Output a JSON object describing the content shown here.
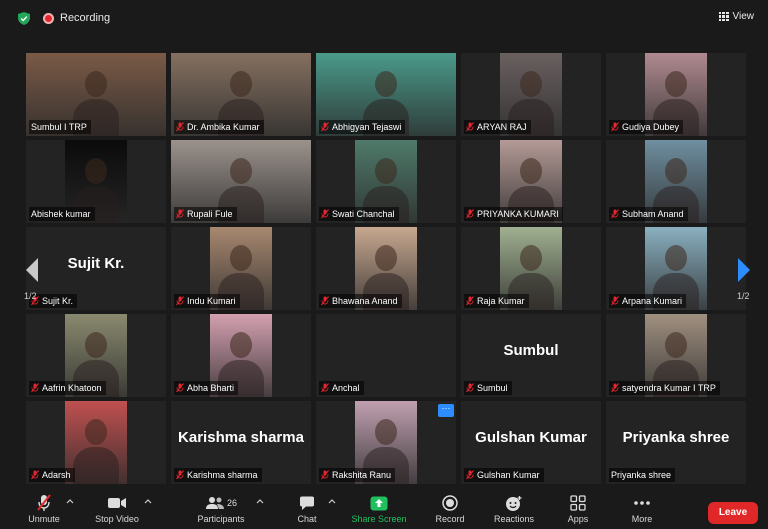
{
  "top_bar": {
    "recording_label": "Recording",
    "view_label": "View"
  },
  "gallery": {
    "page_indicator_left": "1/2",
    "page_indicator_right": "1/2",
    "tiles": [
      {
        "name": "Sumbul I TRP",
        "muted": false,
        "video_tone": "#7a5a47",
        "big_name": ""
      },
      {
        "name": "Dr. Ambika Kumar",
        "muted": true,
        "video_tone": "#857060",
        "big_name": ""
      },
      {
        "name": "Abhigyan Tejaswi",
        "muted": true,
        "video_tone": "#4a9a8a",
        "big_name": ""
      },
      {
        "name": "ARYAN RAJ",
        "muted": true,
        "video_tone": "#6a6060",
        "big_name": ""
      },
      {
        "name": "Gudiya Dubey",
        "muted": true,
        "video_tone": "#b08a90",
        "big_name": ""
      },
      {
        "name": "Abishek kumar",
        "muted": false,
        "video_tone": "#0b0b0b",
        "big_name": ""
      },
      {
        "name": "Rupali Fule",
        "muted": true,
        "video_tone": "#9b928c",
        "big_name": ""
      },
      {
        "name": "Swati Chanchal",
        "muted": true,
        "video_tone": "#4f7a6a",
        "big_name": ""
      },
      {
        "name": "PRIYANKA KUMARI",
        "muted": true,
        "video_tone": "#b49a96",
        "big_name": ""
      },
      {
        "name": "Subham Anand",
        "muted": true,
        "video_tone": "#6f8fa0",
        "big_name": ""
      },
      {
        "name": "Sujit Kr.",
        "muted": true,
        "video_tone": "",
        "big_name": "Sujit Kr."
      },
      {
        "name": "Indu Kumari",
        "muted": true,
        "video_tone": "#a88870",
        "big_name": ""
      },
      {
        "name": "Bhawana Anand",
        "muted": true,
        "video_tone": "#c8a890",
        "big_name": ""
      },
      {
        "name": "Raja Kumar",
        "muted": true,
        "video_tone": "#a0b090",
        "big_name": ""
      },
      {
        "name": "Arpana Kumari",
        "muted": true,
        "video_tone": "#8ab0c0",
        "big_name": ""
      },
      {
        "name": "Aafrin Khatoon",
        "muted": true,
        "video_tone": "#8a8a70",
        "big_name": ""
      },
      {
        "name": "Abha Bharti",
        "muted": true,
        "video_tone": "#d4a0b0",
        "big_name": ""
      },
      {
        "name": "Anchal",
        "muted": true,
        "video_tone": "",
        "big_name": ""
      },
      {
        "name": "Sumbul",
        "muted": true,
        "video_tone": "",
        "big_name": "Sumbul"
      },
      {
        "name": "satyendra Kumar I TRP",
        "muted": true,
        "video_tone": "#a09080",
        "big_name": ""
      },
      {
        "name": "Adarsh",
        "muted": true,
        "video_tone": "#c05050",
        "big_name": ""
      },
      {
        "name": "Karishma sharma",
        "muted": true,
        "video_tone": "",
        "big_name": "Karishma sharma"
      },
      {
        "name": "Rakshita Ranu",
        "muted": true,
        "video_tone": "#c0a0b0",
        "big_name": ""
      },
      {
        "name": "Gulshan Kumar",
        "muted": true,
        "video_tone": "",
        "big_name": "Gulshan Kumar"
      },
      {
        "name": "Priyanka shree",
        "muted": false,
        "video_tone": "",
        "big_name": "Priyanka shree"
      }
    ],
    "more_options_label": "···"
  },
  "toolbar": {
    "unmute": "Unmute",
    "stop_video": "Stop Video",
    "participants": "Participants",
    "participant_count": "26",
    "chat": "Chat",
    "share_screen": "Share Screen",
    "record": "Record",
    "reactions": "Reactions",
    "apps": "Apps",
    "more": "More",
    "leave": "Leave"
  },
  "colors": {
    "active_speaker": "#c6e33b",
    "share_green": "#20c060",
    "leave_red": "#e02828",
    "muted_red": "#e4262d",
    "accent_blue": "#2d8cff"
  },
  "icons": [
    "shield-icon",
    "recording-icon",
    "grid-view-icon",
    "mic-muted-icon",
    "video-camera-icon",
    "participants-icon",
    "chat-icon",
    "share-screen-icon",
    "record-icon",
    "reactions-icon",
    "apps-icon",
    "more-icon",
    "arrow-left-icon",
    "arrow-right-icon"
  ]
}
